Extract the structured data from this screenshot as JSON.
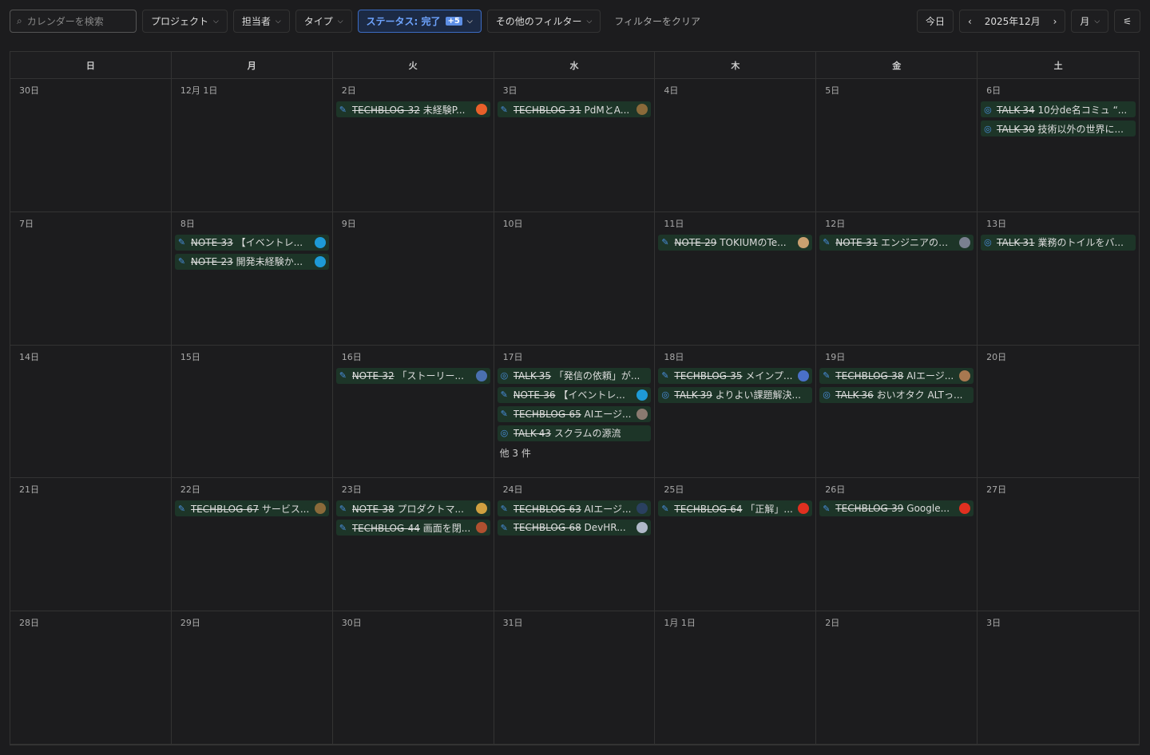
{
  "toolbar": {
    "search_placeholder": "カレンダーを検索",
    "project": "プロジェクト",
    "assignee": "担当者",
    "type": "タイプ",
    "status": "ステータス: 完了",
    "status_badge": "+5",
    "other": "その他のフィルター",
    "clear": "フィルターをクリア",
    "today": "今日",
    "month_label": "2025年12月",
    "view": "月"
  },
  "weekdays": [
    "日",
    "月",
    "火",
    "水",
    "木",
    "金",
    "土"
  ],
  "colors": {
    "event_bg": "#1d3528",
    "accent": "#3c6cc4"
  },
  "weeks": [
    [
      {
        "d": "30日",
        "e": []
      },
      {
        "d": "12月 1日",
        "e": []
      },
      {
        "d": "2日",
        "e": [
          {
            "t": "pen",
            "id": "TECHBLOG-32",
            "title": "未経験P...",
            "av": "#e8602a"
          }
        ]
      },
      {
        "d": "3日",
        "e": [
          {
            "t": "pen",
            "id": "TECHBLOG-31",
            "title": "PdMとA...",
            "av": "#8a6a3a"
          }
        ]
      },
      {
        "d": "4日",
        "e": []
      },
      {
        "d": "5日",
        "e": []
      },
      {
        "d": "6日",
        "e": [
          {
            "t": "talk",
            "id": "TALK-34",
            "title": "10分de名コミュ “..."
          },
          {
            "t": "talk",
            "id": "TALK-30",
            "title": "技術以外の世界に..."
          }
        ]
      }
    ],
    [
      {
        "d": "7日",
        "e": []
      },
      {
        "d": "8日",
        "e": [
          {
            "t": "pen",
            "id": "NOTE-33",
            "title": "【イベントレ...",
            "av": "#1e9ad6"
          },
          {
            "t": "pen",
            "id": "NOTE-23",
            "title": "開発未経験か...",
            "av": "#1e9ad6"
          }
        ]
      },
      {
        "d": "9日",
        "e": []
      },
      {
        "d": "10日",
        "e": []
      },
      {
        "d": "11日",
        "e": [
          {
            "t": "pen",
            "id": "NOTE-29",
            "title": "TOKIUMのTe...",
            "av": "#c9a070"
          }
        ]
      },
      {
        "d": "12日",
        "e": [
          {
            "t": "pen",
            "id": "NOTE-31",
            "title": "エンジニアの評...",
            "av": "#7a8090"
          }
        ]
      },
      {
        "d": "13日",
        "e": [
          {
            "t": "talk",
            "id": "TALK-31",
            "title": "業務のトイルをバ..."
          }
        ]
      }
    ],
    [
      {
        "d": "14日",
        "e": []
      },
      {
        "d": "15日",
        "e": []
      },
      {
        "d": "16日",
        "e": [
          {
            "t": "pen",
            "id": "NOTE-32",
            "title": "「ストーリー...",
            "av": "#4a70b0"
          }
        ]
      },
      {
        "d": "17日",
        "e": [
          {
            "t": "talk",
            "id": "TALK-35",
            "title": "「発信の依頼」が..."
          },
          {
            "t": "pen",
            "id": "NOTE-36",
            "title": "【イベントレ...",
            "av": "#1e9ad6"
          },
          {
            "t": "pen",
            "id": "TECHBLOG-65",
            "title": "AIエージ...",
            "av": "#8a7a70"
          },
          {
            "t": "talk",
            "id": "TALK-43",
            "title": "スクラムの源流"
          }
        ],
        "more": "他 3 件"
      },
      {
        "d": "18日",
        "e": [
          {
            "t": "pen",
            "id": "TECHBLOG-35",
            "title": "メインプ...",
            "av": "#4a70c8"
          },
          {
            "t": "talk",
            "id": "TALK-39",
            "title": "よりよい課題解決..."
          }
        ]
      },
      {
        "d": "19日",
        "e": [
          {
            "t": "pen",
            "id": "TECHBLOG-38",
            "title": "AIエージ...",
            "av": "#a87850"
          },
          {
            "t": "talk",
            "id": "TALK-36",
            "title": "おいオタク ALTっ..."
          }
        ]
      },
      {
        "d": "20日",
        "e": []
      }
    ],
    [
      {
        "d": "21日",
        "e": []
      },
      {
        "d": "22日",
        "e": [
          {
            "t": "pen",
            "id": "TECHBLOG-67",
            "title": "サービス...",
            "av": "#8a6a3a"
          }
        ]
      },
      {
        "d": "23日",
        "e": [
          {
            "t": "pen",
            "id": "NOTE-38",
            "title": "プロダクトマ...",
            "av": "#d0a040"
          },
          {
            "t": "pen",
            "id": "TECHBLOG-44",
            "title": "画面を閉...",
            "av": "#b05030"
          }
        ]
      },
      {
        "d": "24日",
        "e": [
          {
            "t": "pen",
            "id": "TECHBLOG-63",
            "title": "AIエージ...",
            "av": "#2a4060"
          },
          {
            "t": "pen",
            "id": "TECHBLOG-68",
            "title": "DevHR...",
            "av": "#b0b8c8"
          }
        ]
      },
      {
        "d": "25日",
        "e": [
          {
            "t": "pen",
            "id": "TECHBLOG-64",
            "title": "「正解」...",
            "av": "#e03020"
          }
        ]
      },
      {
        "d": "26日",
        "e": [
          {
            "t": "pen",
            "id": "TECHBLOG-39",
            "title": "Google...",
            "av": "#e03020"
          }
        ]
      },
      {
        "d": "27日",
        "e": []
      }
    ],
    [
      {
        "d": "28日",
        "e": []
      },
      {
        "d": "29日",
        "e": []
      },
      {
        "d": "30日",
        "e": []
      },
      {
        "d": "31日",
        "e": []
      },
      {
        "d": "1月 1日",
        "e": []
      },
      {
        "d": "2日",
        "e": []
      },
      {
        "d": "3日",
        "e": []
      }
    ]
  ]
}
